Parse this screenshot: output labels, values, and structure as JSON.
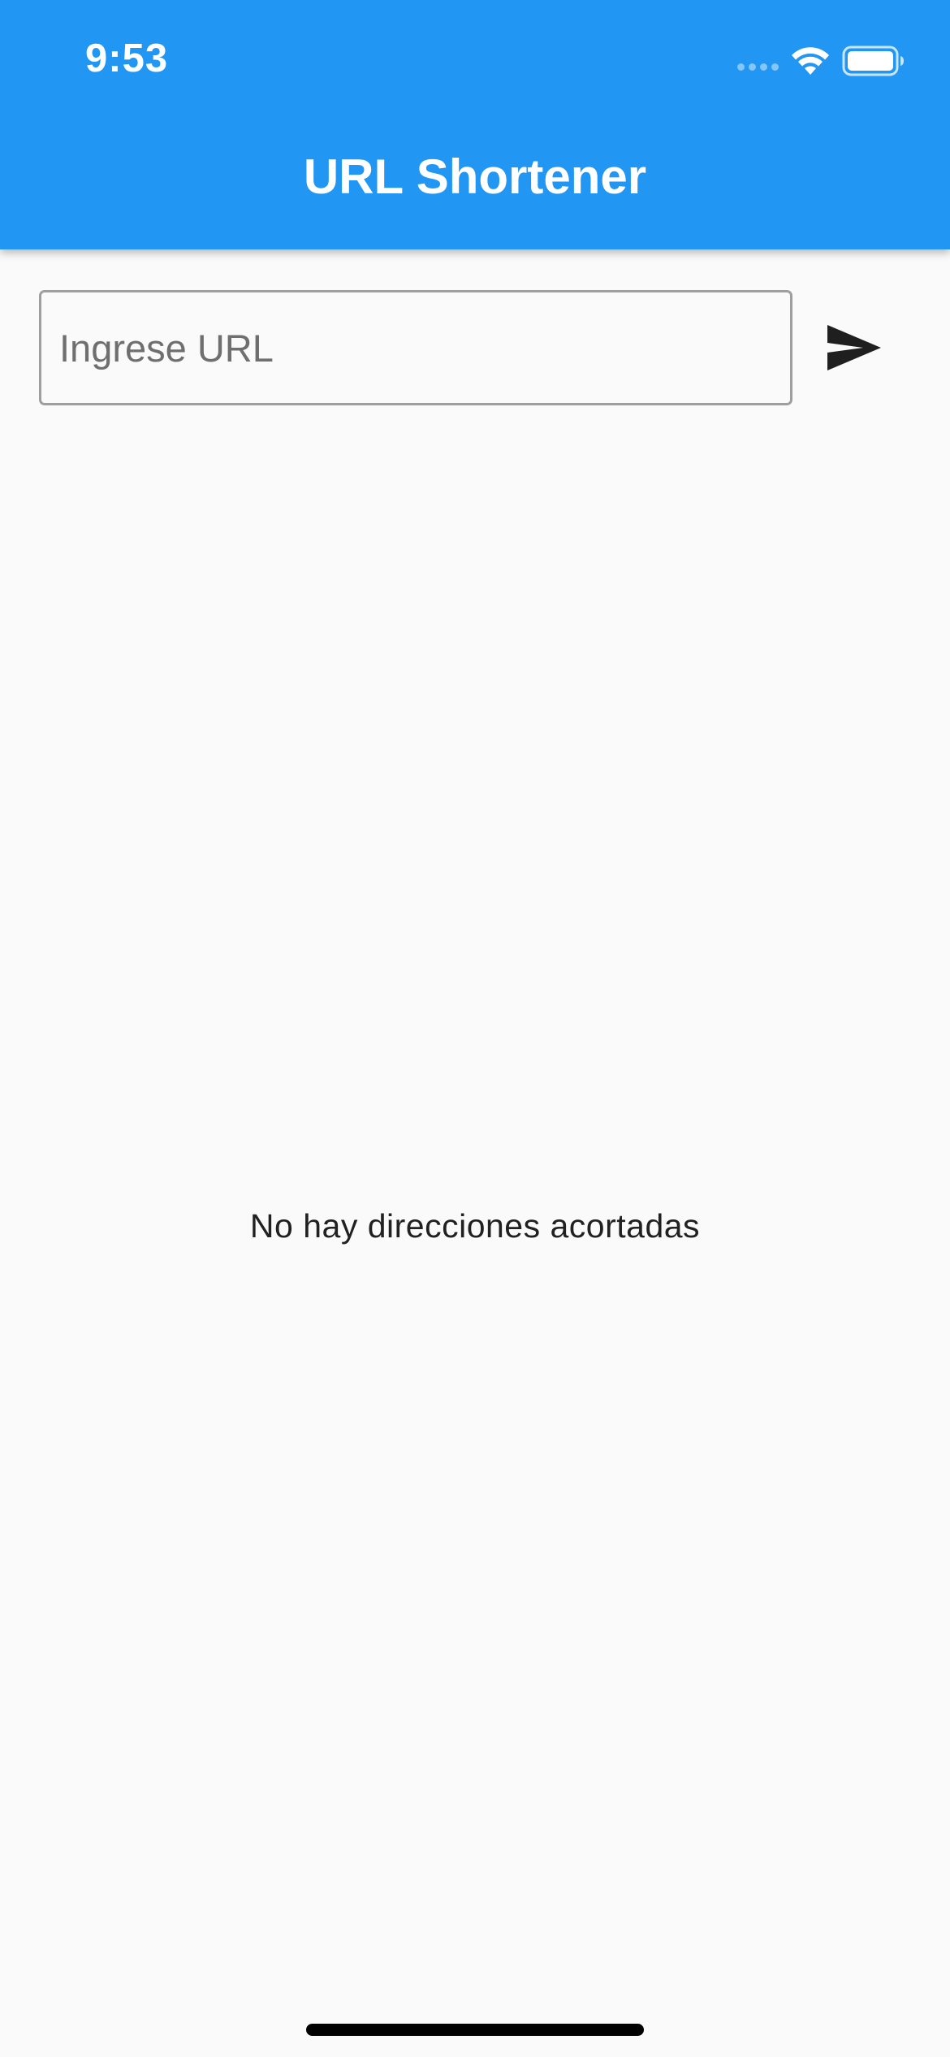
{
  "status_bar": {
    "time": "9:53",
    "icons": [
      "signal-dots-icon",
      "wifi-icon",
      "battery-icon"
    ]
  },
  "app_bar": {
    "title": "URL Shortener",
    "color": "#2196f3"
  },
  "url_input": {
    "placeholder": "Ingrese URL",
    "value": ""
  },
  "send_button": {
    "icon": "send-icon",
    "aria_label": "send"
  },
  "empty_state": {
    "message": "No hay direcciones acortadas"
  }
}
